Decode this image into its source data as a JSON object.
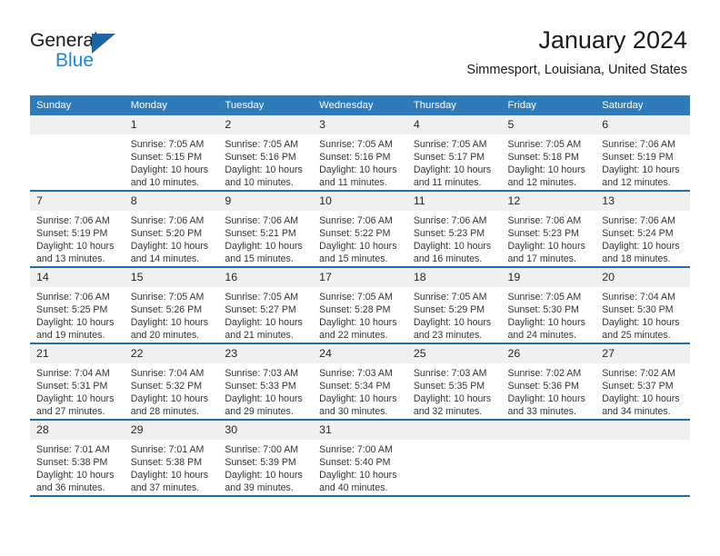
{
  "brand": {
    "word_one": "General",
    "word_two": "Blue",
    "triangle_color": "#1565a8",
    "blue_text_color": "#1c86d8"
  },
  "header": {
    "title": "January 2024",
    "subtitle": "Simmesport, Louisiana, United States"
  },
  "theme": {
    "header_row_bg": "#2f7ab9",
    "header_row_text": "#ffffff",
    "daynum_bg": "#f0f0f0",
    "week_separator": "#1e6daf"
  },
  "weekday_headers": [
    "Sunday",
    "Monday",
    "Tuesday",
    "Wednesday",
    "Thursday",
    "Friday",
    "Saturday"
  ],
  "calendar": {
    "month": "January",
    "year": "2024",
    "weeks": [
      [
        {
          "day": "",
          "sunrise": "",
          "sunset": "",
          "daylight_1": "",
          "daylight_2": ""
        },
        {
          "day": "1",
          "sunrise": "Sunrise: 7:05 AM",
          "sunset": "Sunset: 5:15 PM",
          "daylight_1": "Daylight: 10 hours",
          "daylight_2": "and 10 minutes."
        },
        {
          "day": "2",
          "sunrise": "Sunrise: 7:05 AM",
          "sunset": "Sunset: 5:16 PM",
          "daylight_1": "Daylight: 10 hours",
          "daylight_2": "and 10 minutes."
        },
        {
          "day": "3",
          "sunrise": "Sunrise: 7:05 AM",
          "sunset": "Sunset: 5:16 PM",
          "daylight_1": "Daylight: 10 hours",
          "daylight_2": "and 11 minutes."
        },
        {
          "day": "4",
          "sunrise": "Sunrise: 7:05 AM",
          "sunset": "Sunset: 5:17 PM",
          "daylight_1": "Daylight: 10 hours",
          "daylight_2": "and 11 minutes."
        },
        {
          "day": "5",
          "sunrise": "Sunrise: 7:05 AM",
          "sunset": "Sunset: 5:18 PM",
          "daylight_1": "Daylight: 10 hours",
          "daylight_2": "and 12 minutes."
        },
        {
          "day": "6",
          "sunrise": "Sunrise: 7:06 AM",
          "sunset": "Sunset: 5:19 PM",
          "daylight_1": "Daylight: 10 hours",
          "daylight_2": "and 12 minutes."
        }
      ],
      [
        {
          "day": "7",
          "sunrise": "Sunrise: 7:06 AM",
          "sunset": "Sunset: 5:19 PM",
          "daylight_1": "Daylight: 10 hours",
          "daylight_2": "and 13 minutes."
        },
        {
          "day": "8",
          "sunrise": "Sunrise: 7:06 AM",
          "sunset": "Sunset: 5:20 PM",
          "daylight_1": "Daylight: 10 hours",
          "daylight_2": "and 14 minutes."
        },
        {
          "day": "9",
          "sunrise": "Sunrise: 7:06 AM",
          "sunset": "Sunset: 5:21 PM",
          "daylight_1": "Daylight: 10 hours",
          "daylight_2": "and 15 minutes."
        },
        {
          "day": "10",
          "sunrise": "Sunrise: 7:06 AM",
          "sunset": "Sunset: 5:22 PM",
          "daylight_1": "Daylight: 10 hours",
          "daylight_2": "and 15 minutes."
        },
        {
          "day": "11",
          "sunrise": "Sunrise: 7:06 AM",
          "sunset": "Sunset: 5:23 PM",
          "daylight_1": "Daylight: 10 hours",
          "daylight_2": "and 16 minutes."
        },
        {
          "day": "12",
          "sunrise": "Sunrise: 7:06 AM",
          "sunset": "Sunset: 5:23 PM",
          "daylight_1": "Daylight: 10 hours",
          "daylight_2": "and 17 minutes."
        },
        {
          "day": "13",
          "sunrise": "Sunrise: 7:06 AM",
          "sunset": "Sunset: 5:24 PM",
          "daylight_1": "Daylight: 10 hours",
          "daylight_2": "and 18 minutes."
        }
      ],
      [
        {
          "day": "14",
          "sunrise": "Sunrise: 7:06 AM",
          "sunset": "Sunset: 5:25 PM",
          "daylight_1": "Daylight: 10 hours",
          "daylight_2": "and 19 minutes."
        },
        {
          "day": "15",
          "sunrise": "Sunrise: 7:05 AM",
          "sunset": "Sunset: 5:26 PM",
          "daylight_1": "Daylight: 10 hours",
          "daylight_2": "and 20 minutes."
        },
        {
          "day": "16",
          "sunrise": "Sunrise: 7:05 AM",
          "sunset": "Sunset: 5:27 PM",
          "daylight_1": "Daylight: 10 hours",
          "daylight_2": "and 21 minutes."
        },
        {
          "day": "17",
          "sunrise": "Sunrise: 7:05 AM",
          "sunset": "Sunset: 5:28 PM",
          "daylight_1": "Daylight: 10 hours",
          "daylight_2": "and 22 minutes."
        },
        {
          "day": "18",
          "sunrise": "Sunrise: 7:05 AM",
          "sunset": "Sunset: 5:29 PM",
          "daylight_1": "Daylight: 10 hours",
          "daylight_2": "and 23 minutes."
        },
        {
          "day": "19",
          "sunrise": "Sunrise: 7:05 AM",
          "sunset": "Sunset: 5:30 PM",
          "daylight_1": "Daylight: 10 hours",
          "daylight_2": "and 24 minutes."
        },
        {
          "day": "20",
          "sunrise": "Sunrise: 7:04 AM",
          "sunset": "Sunset: 5:30 PM",
          "daylight_1": "Daylight: 10 hours",
          "daylight_2": "and 25 minutes."
        }
      ],
      [
        {
          "day": "21",
          "sunrise": "Sunrise: 7:04 AM",
          "sunset": "Sunset: 5:31 PM",
          "daylight_1": "Daylight: 10 hours",
          "daylight_2": "and 27 minutes."
        },
        {
          "day": "22",
          "sunrise": "Sunrise: 7:04 AM",
          "sunset": "Sunset: 5:32 PM",
          "daylight_1": "Daylight: 10 hours",
          "daylight_2": "and 28 minutes."
        },
        {
          "day": "23",
          "sunrise": "Sunrise: 7:03 AM",
          "sunset": "Sunset: 5:33 PM",
          "daylight_1": "Daylight: 10 hours",
          "daylight_2": "and 29 minutes."
        },
        {
          "day": "24",
          "sunrise": "Sunrise: 7:03 AM",
          "sunset": "Sunset: 5:34 PM",
          "daylight_1": "Daylight: 10 hours",
          "daylight_2": "and 30 minutes."
        },
        {
          "day": "25",
          "sunrise": "Sunrise: 7:03 AM",
          "sunset": "Sunset: 5:35 PM",
          "daylight_1": "Daylight: 10 hours",
          "daylight_2": "and 32 minutes."
        },
        {
          "day": "26",
          "sunrise": "Sunrise: 7:02 AM",
          "sunset": "Sunset: 5:36 PM",
          "daylight_1": "Daylight: 10 hours",
          "daylight_2": "and 33 minutes."
        },
        {
          "day": "27",
          "sunrise": "Sunrise: 7:02 AM",
          "sunset": "Sunset: 5:37 PM",
          "daylight_1": "Daylight: 10 hours",
          "daylight_2": "and 34 minutes."
        }
      ],
      [
        {
          "day": "28",
          "sunrise": "Sunrise: 7:01 AM",
          "sunset": "Sunset: 5:38 PM",
          "daylight_1": "Daylight: 10 hours",
          "daylight_2": "and 36 minutes."
        },
        {
          "day": "29",
          "sunrise": "Sunrise: 7:01 AM",
          "sunset": "Sunset: 5:38 PM",
          "daylight_1": "Daylight: 10 hours",
          "daylight_2": "and 37 minutes."
        },
        {
          "day": "30",
          "sunrise": "Sunrise: 7:00 AM",
          "sunset": "Sunset: 5:39 PM",
          "daylight_1": "Daylight: 10 hours",
          "daylight_2": "and 39 minutes."
        },
        {
          "day": "31",
          "sunrise": "Sunrise: 7:00 AM",
          "sunset": "Sunset: 5:40 PM",
          "daylight_1": "Daylight: 10 hours",
          "daylight_2": "and 40 minutes."
        },
        {
          "day": "",
          "sunrise": "",
          "sunset": "",
          "daylight_1": "",
          "daylight_2": ""
        },
        {
          "day": "",
          "sunrise": "",
          "sunset": "",
          "daylight_1": "",
          "daylight_2": ""
        },
        {
          "day": "",
          "sunrise": "",
          "sunset": "",
          "daylight_1": "",
          "daylight_2": ""
        }
      ]
    ]
  }
}
